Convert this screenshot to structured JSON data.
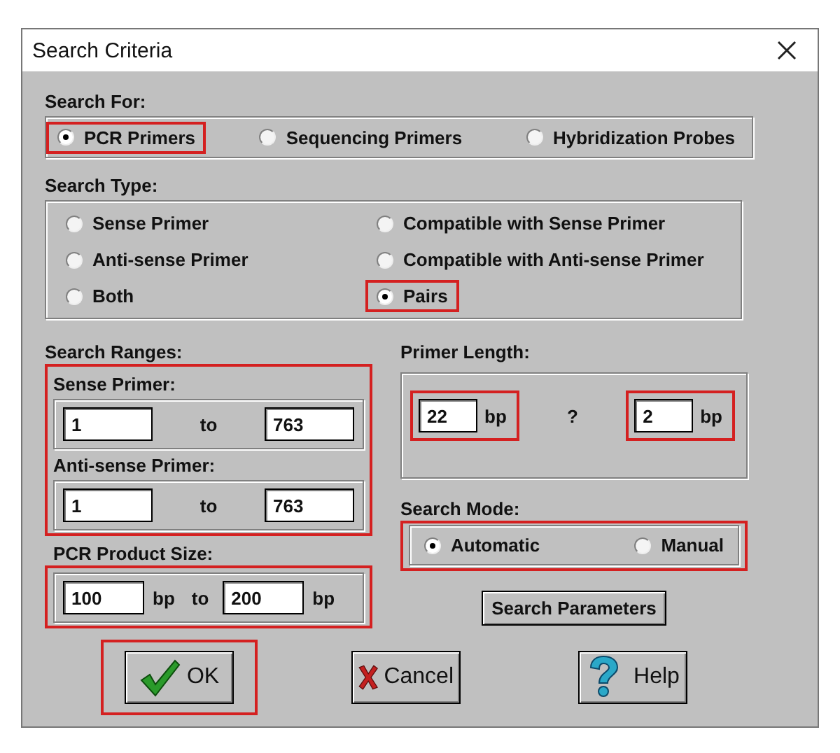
{
  "window": {
    "title": "Search Criteria"
  },
  "search_for": {
    "label": "Search For:",
    "options": [
      {
        "label": "PCR Primers",
        "selected": true,
        "highlighted": true
      },
      {
        "label": "Sequencing Primers",
        "selected": false,
        "highlighted": false
      },
      {
        "label": "Hybridization Probes",
        "selected": false,
        "highlighted": false
      }
    ]
  },
  "search_type": {
    "label": "Search Type:",
    "options": [
      {
        "label": "Sense Primer",
        "selected": false,
        "highlighted": false
      },
      {
        "label": "Compatible with Sense Primer",
        "selected": false,
        "highlighted": false
      },
      {
        "label": "Anti-sense Primer",
        "selected": false,
        "highlighted": false
      },
      {
        "label": "Compatible with Anti-sense Primer",
        "selected": false,
        "highlighted": false
      },
      {
        "label": "Both",
        "selected": false,
        "highlighted": false
      },
      {
        "label": "Pairs",
        "selected": true,
        "highlighted": true
      }
    ]
  },
  "search_ranges": {
    "label": "Search Ranges:",
    "highlighted": true,
    "groups": [
      {
        "label": "Sense Primer:",
        "from": "1",
        "to_label": "to",
        "to": "763"
      },
      {
        "label": "Anti-sense Primer:",
        "from": "1",
        "to_label": "to",
        "to": "763"
      }
    ]
  },
  "pcr_product_size": {
    "label": "PCR Product Size:",
    "highlighted": true,
    "from": "100",
    "from_unit": "bp",
    "to_label": "to",
    "to": "200",
    "to_unit": "bp"
  },
  "primer_length": {
    "label": "Primer Length:",
    "separator": "?",
    "fields": [
      {
        "value": "22",
        "unit": "bp",
        "highlighted": true
      },
      {
        "value": "2",
        "unit": "bp",
        "highlighted": true
      }
    ]
  },
  "search_mode": {
    "label": "Search Mode:",
    "highlighted": true,
    "options": [
      {
        "label": "Automatic",
        "selected": true
      },
      {
        "label": "Manual",
        "selected": false
      }
    ]
  },
  "search_parameters_button": "Search Parameters",
  "buttons": [
    {
      "kind": "ok",
      "label": "OK",
      "highlighted": true
    },
    {
      "kind": "cancel",
      "label": "Cancel",
      "highlighted": false
    },
    {
      "kind": "help",
      "label": "Help",
      "highlighted": false
    }
  ]
}
